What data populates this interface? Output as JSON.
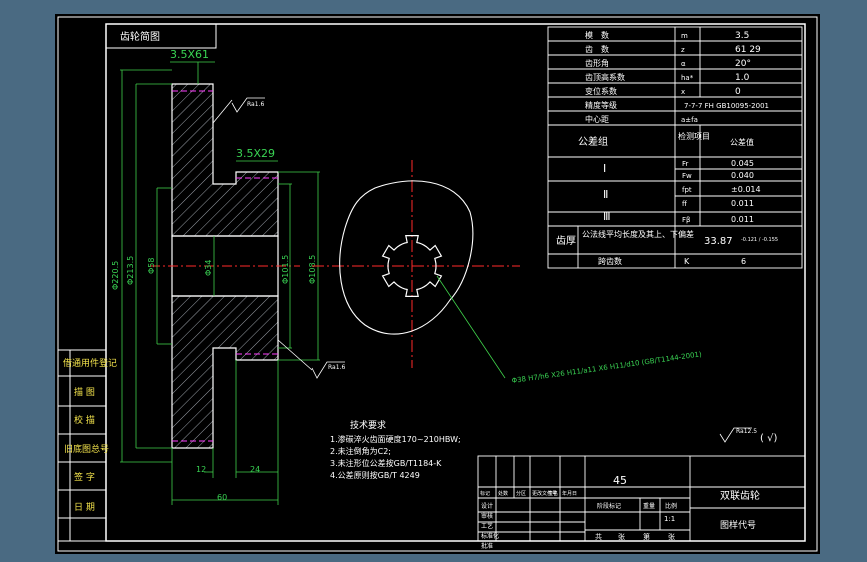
{
  "colors": {
    "background": "#000000",
    "window": "#4a6a82",
    "line": "#ffffff",
    "dimension": "#3fcf4a",
    "center": "#ff2a2a",
    "hatch": "#9aa0a8",
    "accent": "#ff3fff",
    "text_yellow": "#f2e24b"
  },
  "top_label": "齿轮简图",
  "module_label": "3.5X61",
  "module_label2": "3.5X29",
  "roughness_1": "Ra1.6",
  "roughness_2": "Ra1.6",
  "roughness_default": "Ra12.5",
  "roughness_default_suffix": "( √)",
  "dims": {
    "d1": "Φ220.5",
    "d2": "Φ213.5",
    "d3": "Φ58",
    "d4": "Φ34",
    "d5": "Φ101.5",
    "d6": "Φ108.5",
    "w1": "12",
    "w2": "24",
    "w3": "60"
  },
  "spline_callout": "Φ38 H7/h6 X26 H11/a11 X6 H11/d10 (GB/T1144-2001)",
  "params": {
    "rows": [
      {
        "name": "模　数",
        "sym": "m",
        "val": "3.5"
      },
      {
        "name": "齿　数",
        "sym": "z",
        "val": "61  29"
      },
      {
        "name": "齿形角",
        "sym": "α",
        "val": "20°"
      },
      {
        "name": "齿顶高系数",
        "sym": "ha*",
        "val": "1.0"
      },
      {
        "name": "变位系数",
        "sym": "x",
        "val": "0"
      },
      {
        "name": "精度等级",
        "sym": "",
        "val": "7-7-7 FH GB10095-2001"
      },
      {
        "name": "中心距",
        "sym": "a±fa",
        "val": ""
      }
    ],
    "tol_header": {
      "group": "公差组",
      "item": "检测项目",
      "value": "公差值"
    },
    "tol_rows": [
      {
        "grp": "Ⅰ",
        "sym": "Fr",
        "val": "0.045"
      },
      {
        "grp": "",
        "sym": "Fw",
        "val": "0.040"
      },
      {
        "grp": "Ⅱ",
        "sym": "fpt",
        "val": "±0.014"
      },
      {
        "grp": "",
        "sym": "ff",
        "val": "0.011"
      },
      {
        "grp": "Ⅲ",
        "sym": "Fβ",
        "val": "0.011"
      }
    ],
    "thick_label": "齿厚",
    "thick_desc": "公法线平均长度及其上、下偏差",
    "thick_val": "33.87",
    "thick_dev": "-0.121 / -0.155",
    "mesh_label": "跨齿数",
    "mesh_sym": "K",
    "mesh_val": "6"
  },
  "tech": {
    "title": "技术要求",
    "items": [
      "1.渗碳淬火齿面硬度170~210HBW;",
      "2.未注倒角为C2;",
      "3.未注形位公差按GB/T1184-K",
      "4.公差原则按GB/T 4249"
    ]
  },
  "side_labels": [
    "借通用件登记",
    "描 图",
    "校 描",
    "旧底图总号",
    "签 字",
    "日 期"
  ],
  "title_block": {
    "material": "45",
    "part_name": "双联齿轮",
    "drawing_no": "图样代号",
    "scale": "1:1",
    "row_labels": [
      "标记",
      "处数",
      "分区",
      "更改文件号",
      "签名",
      "年月日"
    ],
    "role_labels": [
      "设计",
      "审核",
      "工艺",
      "标准化",
      "批准"
    ],
    "stage_labels": [
      "阶段标记",
      "重量",
      "比例"
    ],
    "sheet_labels": [
      "共",
      "张",
      "第",
      "张"
    ]
  }
}
